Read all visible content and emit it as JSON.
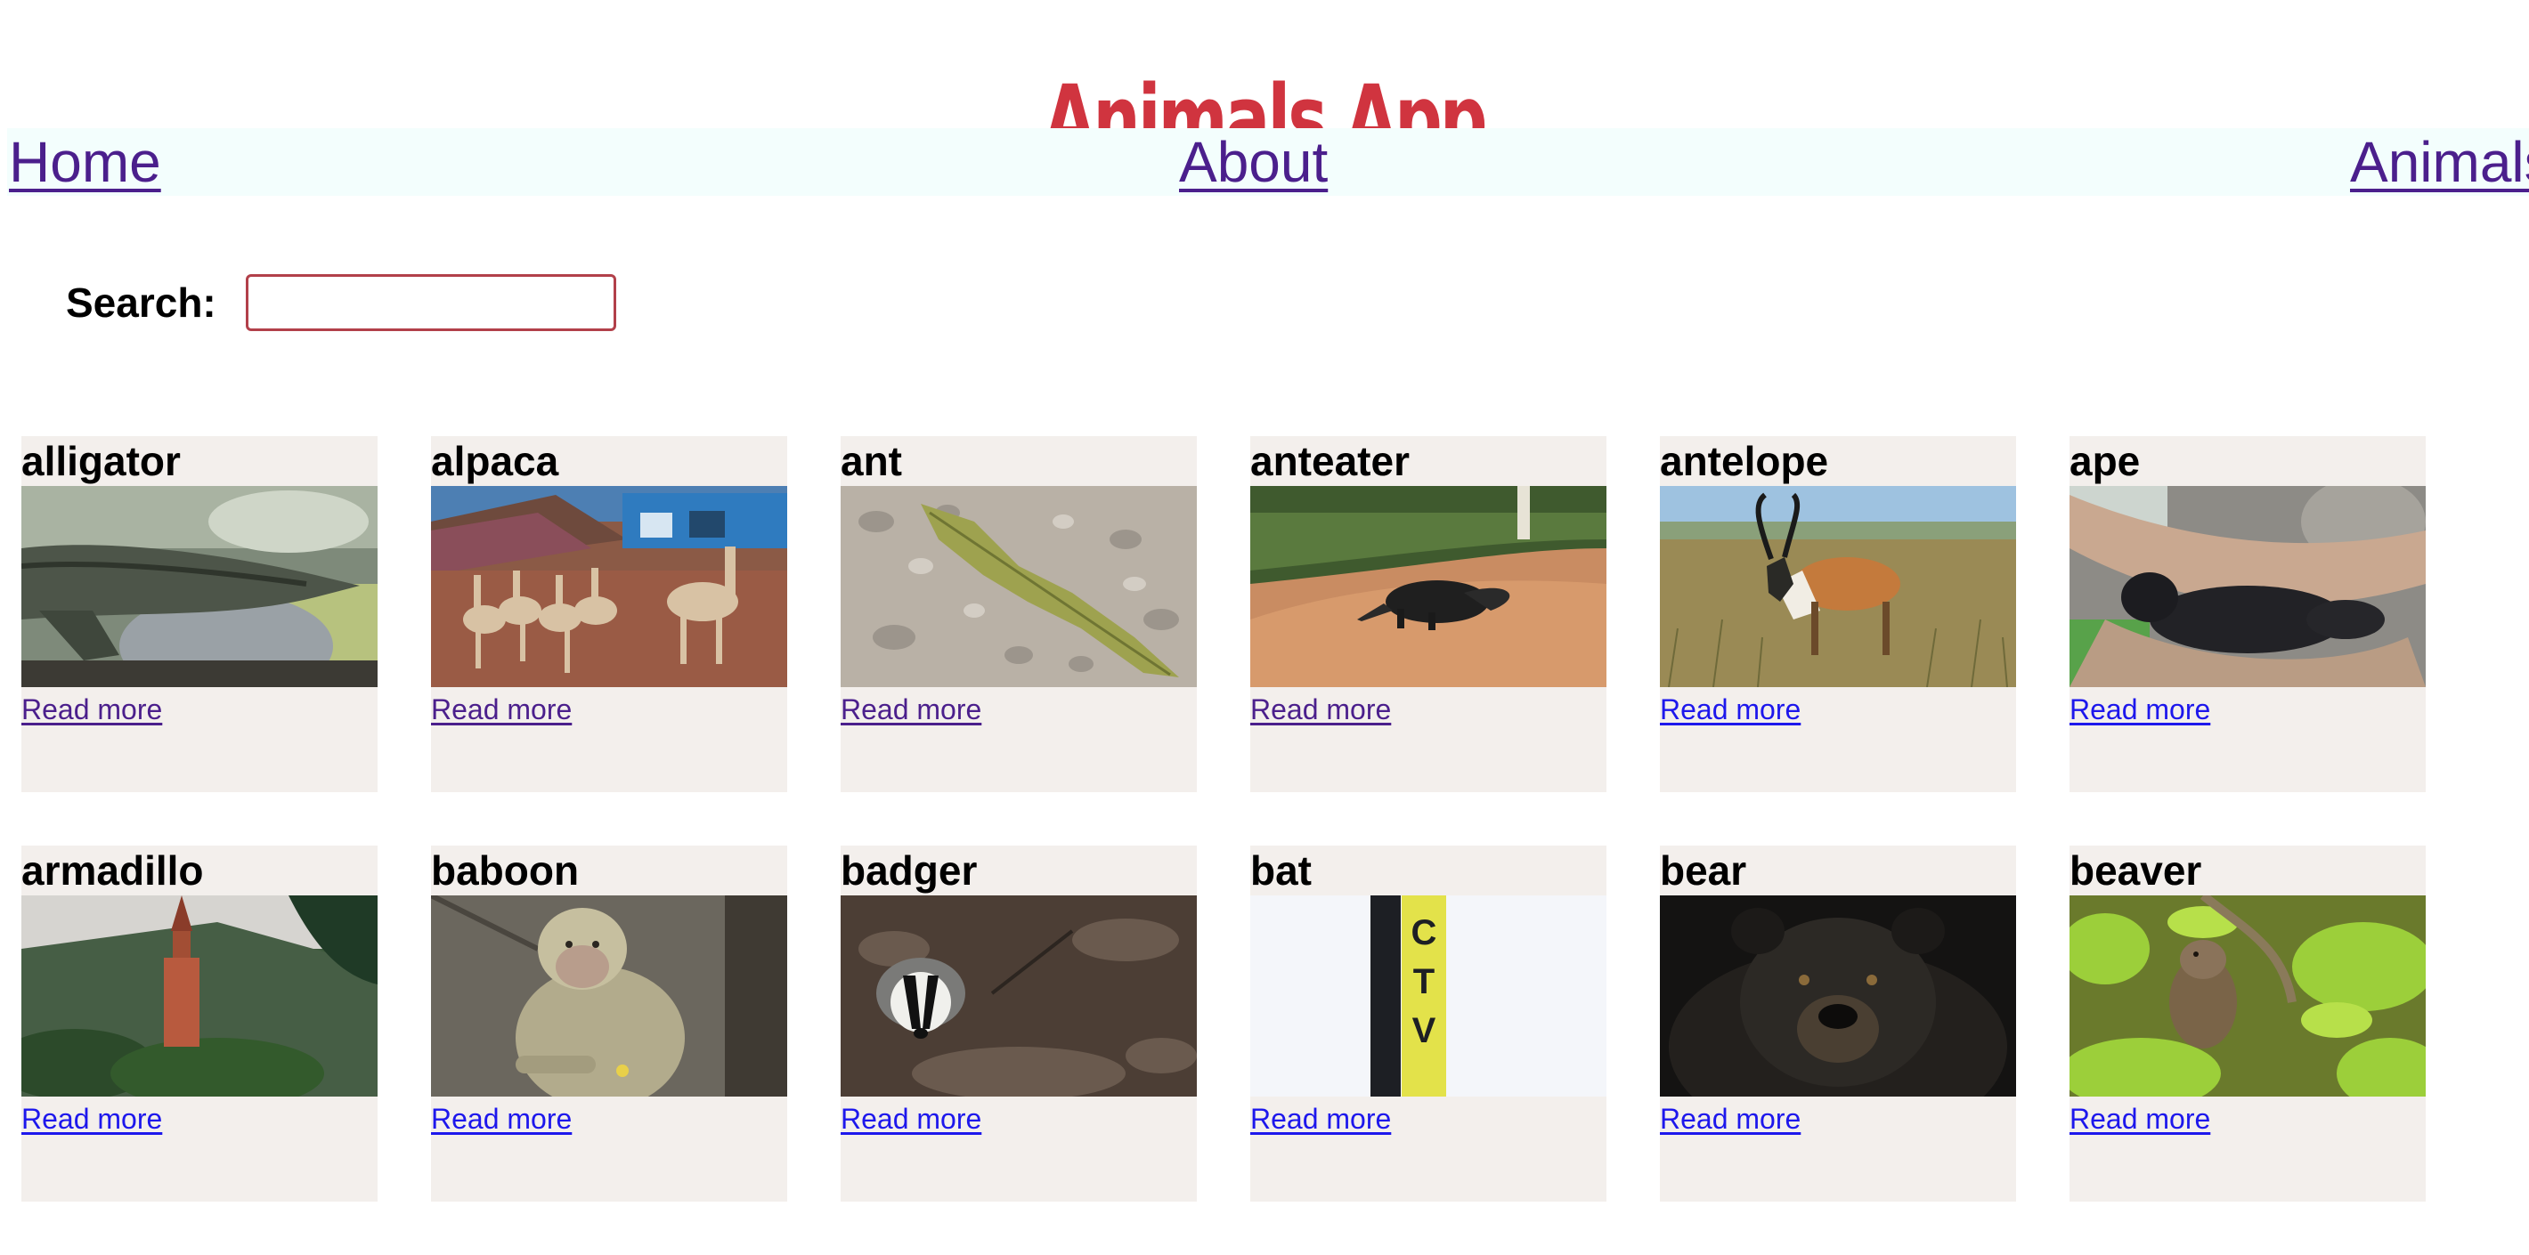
{
  "app": {
    "title": "Animals App"
  },
  "nav": {
    "home": "Home",
    "about": "About",
    "animals": "Animals"
  },
  "search": {
    "label": "Search:",
    "value": "",
    "placeholder": ""
  },
  "cards": [
    {
      "name": "alligator",
      "link": "Read more",
      "link_visited": true,
      "photo": "alligator"
    },
    {
      "name": "alpaca",
      "link": "Read more",
      "link_visited": true,
      "photo": "alpaca"
    },
    {
      "name": "ant",
      "link": "Read more",
      "link_visited": true,
      "photo": "ant"
    },
    {
      "name": "anteater",
      "link": "Read more",
      "link_visited": true,
      "photo": "anteater"
    },
    {
      "name": "antelope",
      "link": "Read more",
      "link_visited": false,
      "photo": "antelope"
    },
    {
      "name": "ape",
      "link": "Read more",
      "link_visited": false,
      "photo": "ape"
    },
    {
      "name": "armadillo",
      "link": "Read more",
      "link_visited": false,
      "photo": "armadillo"
    },
    {
      "name": "baboon",
      "link": "Read more",
      "link_visited": false,
      "photo": "baboon"
    },
    {
      "name": "badger",
      "link": "Read more",
      "link_visited": false,
      "photo": "badger"
    },
    {
      "name": "bat",
      "link": "Read more",
      "link_visited": false,
      "photo": "bat"
    },
    {
      "name": "bear",
      "link": "Read more",
      "link_visited": false,
      "photo": "bear"
    },
    {
      "name": "beaver",
      "link": "Read more",
      "link_visited": false,
      "photo": "beaver"
    }
  ],
  "colors": {
    "title": "#d0343f",
    "nav_bg": "#f3fefd",
    "link_visited": "#4b1f8c",
    "link_unvisited": "#1d17ec",
    "card_bg": "#f3efec",
    "search_border": "#b2404a"
  }
}
